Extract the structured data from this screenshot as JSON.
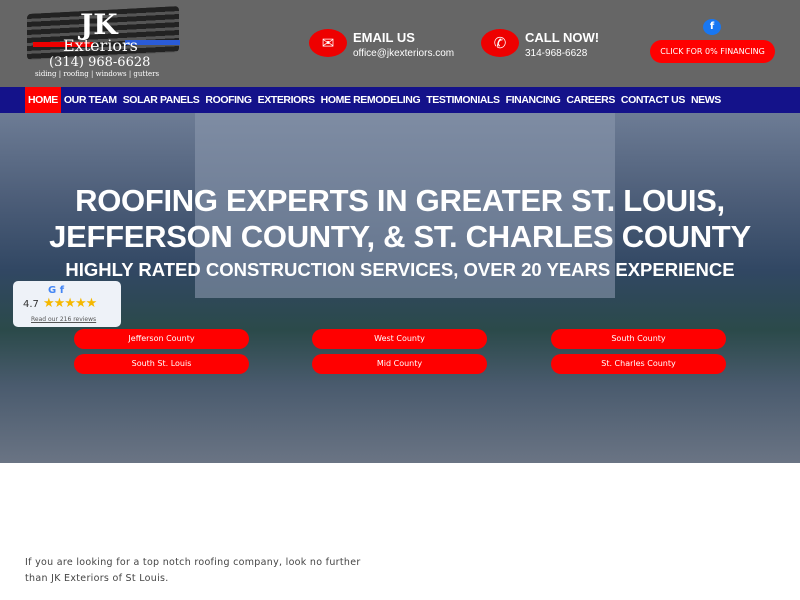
{
  "logo": {
    "brand": "JK",
    "sub": "Exteriors",
    "phone": "(314) 968-6628",
    "tagline": "siding | roofing | windows | gutters"
  },
  "contact": {
    "email_title": "EMAIL US",
    "email": "office@jkexteriors.com",
    "call_title": "CALL NOW!",
    "phone": "314-968-6628"
  },
  "social": {
    "facebook": "f"
  },
  "financing_button": "CLICK FOR 0% FINANCING",
  "nav": [
    "HOME",
    "OUR TEAM",
    "SOLAR PANELS",
    "ROOFING",
    "EXTERIORS",
    "HOME REMODELING",
    "TESTIMONIALS",
    "FINANCING",
    "CAREERS",
    "CONTACT US",
    "NEWS"
  ],
  "hero": {
    "title": "ROOFING EXPERTS IN GREATER ST. LOUIS, JEFFERSON COUNTY, & ST. CHARLES COUNTY",
    "subtitle": "HIGHLY RATED CONSTRUCTION SERVICES, OVER 20 YEARS EXPERIENCE"
  },
  "reviews": {
    "icons": "G f",
    "score": "4.7",
    "stars": "★★★★★",
    "link": "Read our 216 reviews",
    "rating": 4.7
  },
  "areas": [
    "Jefferson County",
    "West County",
    "South County",
    "South St. Louis",
    "Mid County",
    "St. Charles County"
  ],
  "intro": "If you are looking for a top notch roofing company, look no further than JK Exteriors of St Louis."
}
